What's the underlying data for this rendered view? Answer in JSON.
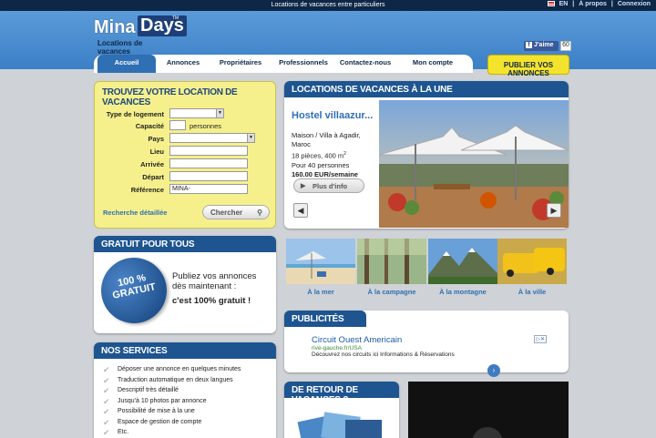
{
  "topbar": {
    "tagline": "Locations de vacances entre particuliers",
    "lang": "EN",
    "sep1": "|",
    "about": "À propos",
    "sep2": "|",
    "login": "Connexion"
  },
  "logo": {
    "mina": "Mina",
    "days": "Days",
    "tm": "TM",
    "subtitle": "Locations de vacances"
  },
  "facebook": {
    "like_label": "J'aime",
    "count": "60"
  },
  "nav": {
    "active": "Accueil",
    "items": [
      "Annonces",
      "Propriétaires",
      "Professionnels",
      "Contactez-nous",
      "Mon compte"
    ],
    "publish": "PUBLIER VOS ANNONCES"
  },
  "search": {
    "title": "TROUVEZ VOTRE LOCATION DE VACANCES",
    "fields": {
      "type": "Type de logement",
      "capacity": "Capacité",
      "capacity_unit": "personnes",
      "country": "Pays",
      "place": "Lieu",
      "arrival": "Arrivée",
      "departure": "Départ",
      "reference": "Référence"
    },
    "reference_value": "MINA-",
    "advanced": "Recherche détaillée",
    "button": "Chercher"
  },
  "featured": {
    "title": "LOCATIONS DE VACANCES À LA UNE",
    "name": "Hostel villaazur...",
    "type": "Maison / Villa à Agadir,",
    "country": "Maroc",
    "size": "18 pièces, 400 m",
    "size_sup": "2",
    "capacity": "Pour 40 personnes",
    "price": "160.00 EUR/semaine",
    "more": "Plus d'info"
  },
  "free": {
    "title": "GRATUIT POUR TOUS",
    "seal_pct": "100 %",
    "seal_word": "GRATUIT",
    "line1": "Publiez vos annonces",
    "line2": "dès maintenant :",
    "line3": "c'est 100% gratuit !"
  },
  "services": {
    "title": "NOS SERVICES",
    "items": [
      "Déposer une annonce en quelques minutes",
      "Traduction automatique en deux langues",
      "Descriptif très détaillé",
      "Jusqu'à 10 photos par annonce",
      "Possibilité de mise à la une",
      "Espace de gestion de compte",
      "Etc."
    ]
  },
  "categories": [
    "À la mer",
    "À la campagne",
    "À la montagne",
    "À la ville"
  ],
  "ads": {
    "title": "PUBLICITÉS",
    "headline": "Circuit Ouest Americain",
    "url": "rive-gauche.fr/USA",
    "desc": "Découvrez nos circuits ici Informations & Réservations",
    "choices": "▷✕"
  },
  "retour": {
    "title": "DE RETOUR DE VACANCES ?"
  }
}
